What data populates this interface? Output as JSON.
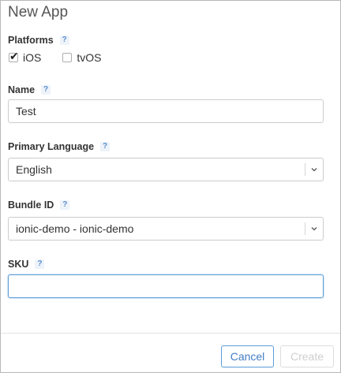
{
  "dialog": {
    "title": "New App"
  },
  "platforms": {
    "label": "Platforms",
    "help": "?",
    "options": [
      {
        "label": "iOS",
        "checked": true
      },
      {
        "label": "tvOS",
        "checked": false
      }
    ]
  },
  "name": {
    "label": "Name",
    "help": "?",
    "value": "Test"
  },
  "primary_language": {
    "label": "Primary Language",
    "help": "?",
    "value": "English"
  },
  "bundle_id": {
    "label": "Bundle ID",
    "help": "?",
    "value": "ionic-demo - ionic-demo"
  },
  "sku": {
    "label": "SKU",
    "help": "?",
    "value": ""
  },
  "footer": {
    "cancel_label": "Cancel",
    "create_label": "Create"
  },
  "colors": {
    "accent": "#5b9dd9",
    "disabled_text": "#cfcfcf"
  },
  "icons": {
    "help": "question-icon",
    "select": "chevron-down-icon",
    "check": "checkmark-icon"
  }
}
